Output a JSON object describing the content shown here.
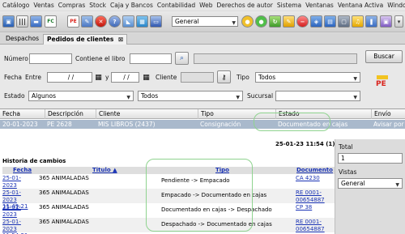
{
  "menu": [
    "Catálogo",
    "Ventas",
    "Compras",
    "Stock",
    "Caja y Bancos",
    "Contabilidad",
    "Web",
    "Derechos de autor",
    "Sistema",
    "Ventanas",
    "Ventana Activa",
    "Window"
  ],
  "toolbar": {
    "layout_select": "General",
    "icons": [
      "save-icon",
      "barcode-icon",
      "truck-icon",
      "fc-document-icon",
      "pe-document-icon",
      "tools-icon",
      "close-icon",
      "help-icon",
      "chart-icon",
      "grid-icon",
      "monitor-icon",
      "circle-icon",
      "circle-icon",
      "refresh-icon",
      "edit-icon",
      "minus-circle-icon",
      "palette-icon",
      "image-icon",
      "window-icon",
      "bell-icon",
      "book-icon"
    ],
    "fc_label": "FC",
    "pe_label": "PE"
  },
  "tabs": [
    {
      "label": "Despachos",
      "active": false
    },
    {
      "label": "Pedidos de clientes",
      "active": true,
      "close": "⊠"
    }
  ],
  "filters": {
    "numero_label": "Número",
    "contiene_label": "Contiene el libro",
    "buscar": "Buscar",
    "fecha_label": "Fecha",
    "entre_label": "Entre",
    "date_from": "/ /",
    "y_label": "y",
    "date_to": "/ /",
    "cliente_label": "Cliente",
    "tipo_label": "Tipo",
    "tipo_value": "Todos",
    "estado_label": "Estado",
    "estado_value": "Algunos",
    "estado2_value": "Todos",
    "sucursal_label": "Sucursal",
    "pe_label": "PE"
  },
  "grid": {
    "headers": [
      "Fecha",
      "Descripción",
      "Cliente",
      "Tipo",
      "Estado",
      "Envío"
    ],
    "row": [
      "20-01-2023",
      "PE 2628",
      "MIS LIBROS (2437)",
      "Consignación",
      "Documentado en cajas",
      "Avisar por"
    ]
  },
  "history": {
    "timestamp": "25-01-23 11:54 (1)",
    "title": "Historia de cambios",
    "headers": {
      "fecha": "Fecha",
      "titulo": "Titulo ▲",
      "tipo": "Tipo",
      "documento": "Documento"
    },
    "rows": [
      {
        "fecha": "25-01-2023 11:47:44",
        "titulo": "365 ANIMALADAS",
        "tipo": "Pendiente -> Empacado",
        "documento": "CA 4230"
      },
      {
        "fecha": "25-01-2023 11:49:21",
        "titulo": "365 ANIMALADAS",
        "tipo": "Empacado -> Documentado en cajas",
        "documento": "RE 0001-00654887"
      },
      {
        "fecha": "25-01-2023 11:52:45",
        "titulo": "365 ANIMALADAS",
        "tipo": "Documentado en cajas -> Despachado",
        "documento": "CP 38"
      },
      {
        "fecha": "25-01-2023 11:54:21",
        "titulo": "365 ANIMALADAS",
        "tipo": "Despachado -> Documentado en cajas",
        "documento": "RE 0001-00654887"
      }
    ]
  },
  "side": {
    "total_label": "Total",
    "total_value": "1",
    "vistas_label": "Vistas",
    "vistas_value": "General"
  },
  "colors": {
    "selected_row": "#a9b9cc",
    "highlight": "#8fd38f",
    "pe_red": "#d9241c",
    "link": "#1a33b5"
  }
}
